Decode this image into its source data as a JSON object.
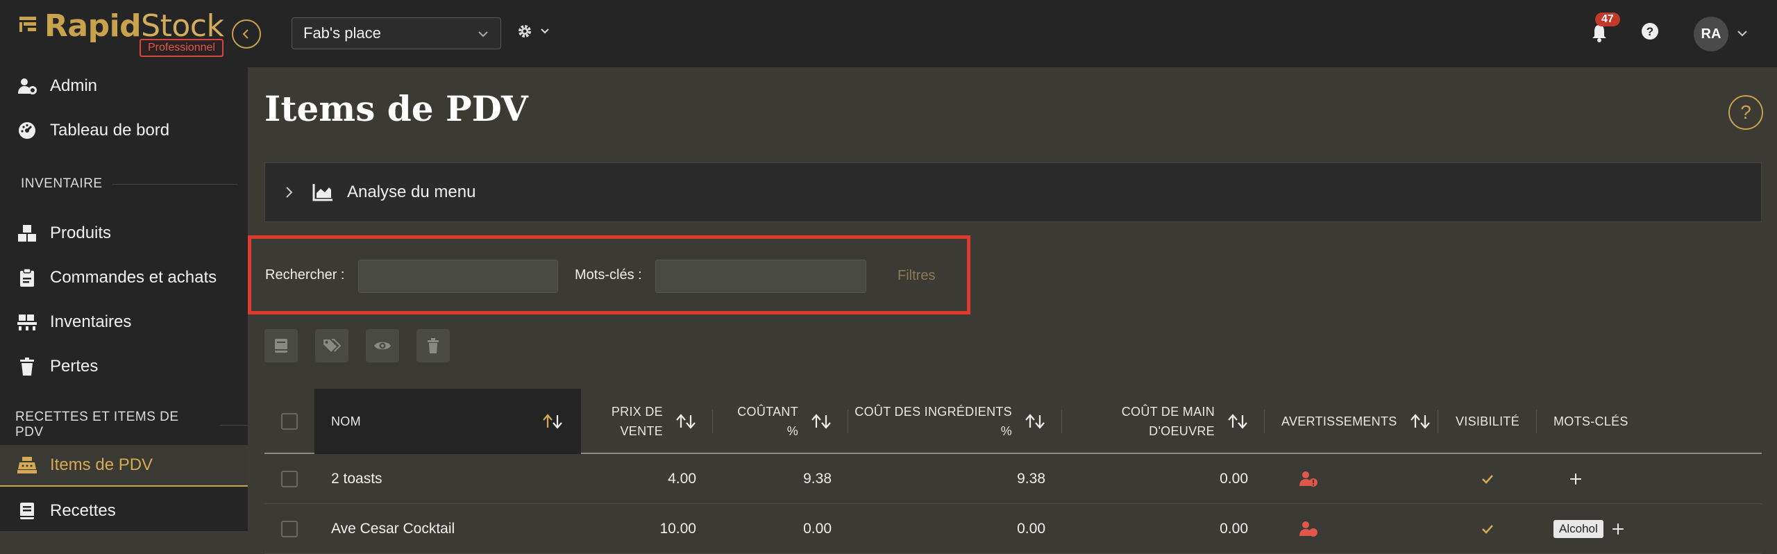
{
  "app": {
    "brand_bold": "Rapid",
    "brand_light": "Stock",
    "edition": "Professionnel",
    "brand_color": "#c9a24d"
  },
  "header": {
    "store": "Fab's place",
    "notifications_count": "47",
    "user_initials": "RA"
  },
  "sidebar": {
    "items_top": [
      {
        "label": "Admin",
        "icon": "user-cog-icon"
      },
      {
        "label": "Tableau de bord",
        "icon": "dashboard-gauge-icon"
      }
    ],
    "section_inventory": "INVENTAIRE",
    "items_inventory": [
      {
        "label": "Produits",
        "icon": "boxes-icon"
      },
      {
        "label": "Commandes et achats",
        "icon": "clipboard-icon"
      },
      {
        "label": "Inventaires",
        "icon": "pallet-icon"
      },
      {
        "label": "Pertes",
        "icon": "trash-icon"
      }
    ],
    "section_recipes": "RECETTES ET ITEMS DE PDV",
    "items_recipes": [
      {
        "label": "Items de PDV",
        "icon": "cash-register-icon",
        "active": true
      },
      {
        "label": "Recettes",
        "icon": "book-icon"
      }
    ]
  },
  "page": {
    "title": "Items de PDV",
    "help": "?"
  },
  "accordion": {
    "label": "Analyse du menu"
  },
  "filters": {
    "search_label": "Rechercher :",
    "search_value": "",
    "keywords_label": "Mots-clés :",
    "keywords_value": "",
    "filters_button": "Filtres"
  },
  "toolbar": [
    "book-icon",
    "tags-icon",
    "eye-icon",
    "trash-icon"
  ],
  "table": {
    "columns": {
      "name": "NOM",
      "price": [
        "PRIX DE",
        "VENTE"
      ],
      "cost_pct": [
        "COÛTANT",
        "%"
      ],
      "ingr_cost": [
        "COÛT DES INGRÉDIENTS",
        "%"
      ],
      "labor_cost": [
        "COÛT DE MAIN",
        "D'OEUVRE"
      ],
      "warnings": "AVERTISSEMENTS",
      "visibility": "VISIBILITÉ",
      "keywords": "MOTS-CLÉS"
    },
    "rows": [
      {
        "name": "2 toasts",
        "price": "4.00",
        "cost_pct": "9.38",
        "ingr_cost": "9.38",
        "labor_cost": "0.00",
        "tag": ""
      },
      {
        "name": "Ave Cesar Cocktail",
        "price": "10.00",
        "cost_pct": "0.00",
        "ingr_cost": "0.00",
        "labor_cost": "0.00",
        "tag": "Alcohol"
      }
    ]
  }
}
